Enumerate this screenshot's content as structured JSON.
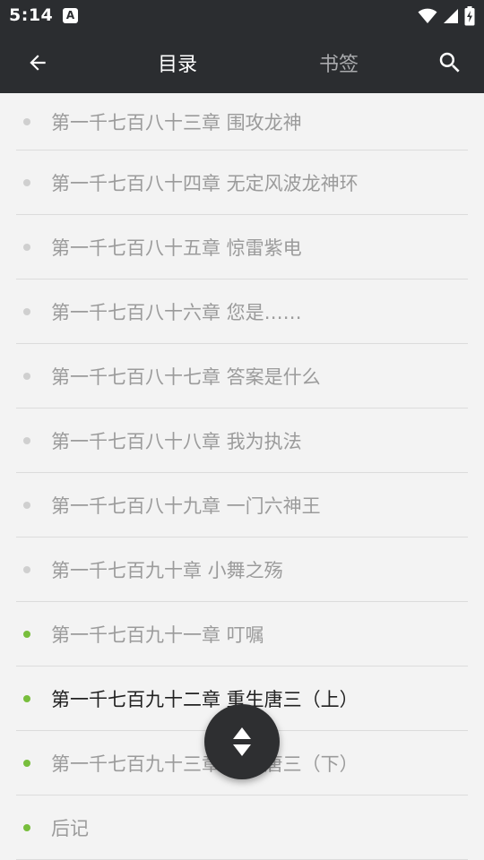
{
  "status_bar": {
    "time": "5:14",
    "notification_icon": "A",
    "icons": [
      "wifi-icon",
      "signal-icon",
      "battery-charging-icon"
    ]
  },
  "app_bar": {
    "back_icon": "arrow-left-icon",
    "tabs": [
      {
        "label": "目录",
        "active": true
      },
      {
        "label": "书签",
        "active": false
      }
    ],
    "search_icon": "search-icon"
  },
  "chapters": [
    {
      "title": "第一千七百八十三章 围攻龙神",
      "cached": false,
      "current": false
    },
    {
      "title": "第一千七百八十四章 无定风波龙神环",
      "cached": false,
      "current": false
    },
    {
      "title": "第一千七百八十五章 惊雷紫电",
      "cached": false,
      "current": false
    },
    {
      "title": "第一千七百八十六章 您是……",
      "cached": false,
      "current": false
    },
    {
      "title": "第一千七百八十七章 答案是什么",
      "cached": false,
      "current": false
    },
    {
      "title": "第一千七百八十八章 我为执法",
      "cached": false,
      "current": false
    },
    {
      "title": "第一千七百八十九章 一门六神王",
      "cached": false,
      "current": false
    },
    {
      "title": "第一千七百九十章 小舞之殇",
      "cached": false,
      "current": false
    },
    {
      "title": "第一千七百九十一章 叮嘱",
      "cached": true,
      "current": false
    },
    {
      "title": "第一千七百九十二章 重生唐三（上）",
      "cached": true,
      "current": true
    },
    {
      "title": "第一千七百九十三章 重生唐三（下）",
      "cached": true,
      "current": false
    },
    {
      "title": "后记",
      "cached": true,
      "current": false
    }
  ],
  "fab": {
    "icon": "scroll-up-down-icon"
  },
  "colors": {
    "bar_background": "#2b2d30",
    "list_background": "#f3f3f3",
    "cached_dot": "#78be3c",
    "uncached_dot": "#cfcfcf",
    "text_read": "#9b9b9b",
    "text_current": "#222222"
  }
}
